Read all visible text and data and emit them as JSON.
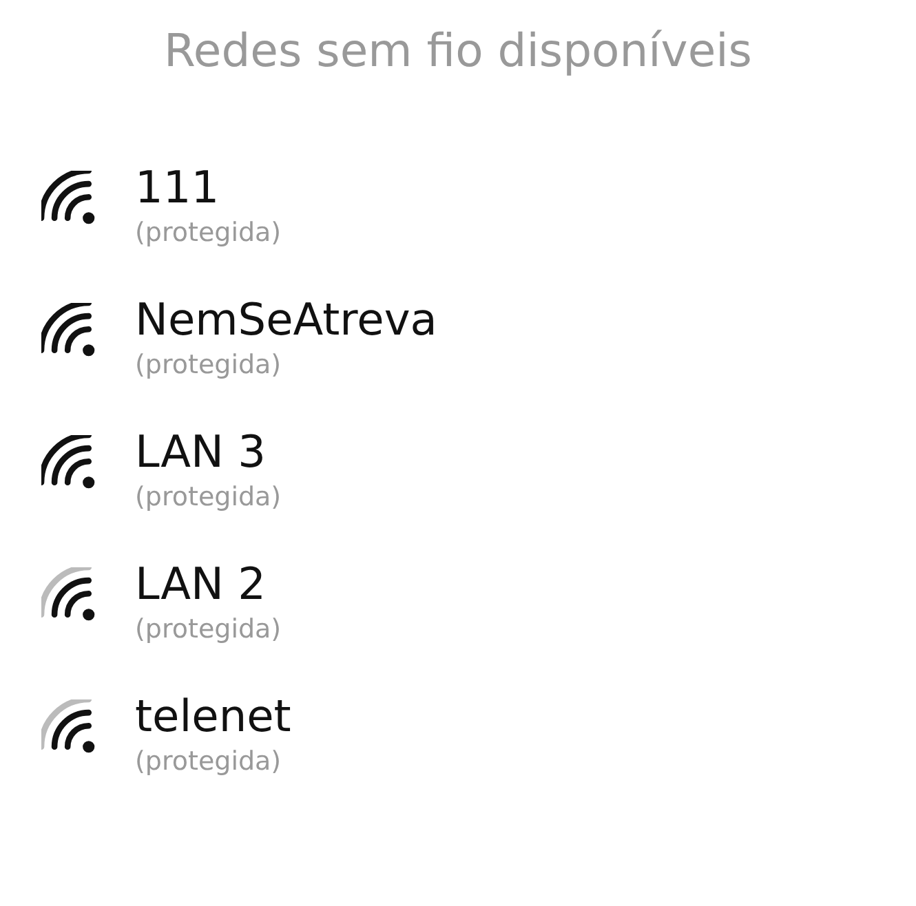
{
  "title": "Redes sem fio disponíveis",
  "networks": [
    {
      "name": "111",
      "status": "(protegida)",
      "kind": "strong"
    },
    {
      "name": "NemSeAtreva",
      "status": "(protegida)",
      "kind": "strong"
    },
    {
      "name": "LAN 3",
      "status": "(protegida)",
      "kind": "strong"
    },
    {
      "name": "LAN 2",
      "status": "(protegida)",
      "kind": "medium"
    },
    {
      "name": "telenet",
      "status": "(protegida)",
      "kind": "medium"
    }
  ]
}
